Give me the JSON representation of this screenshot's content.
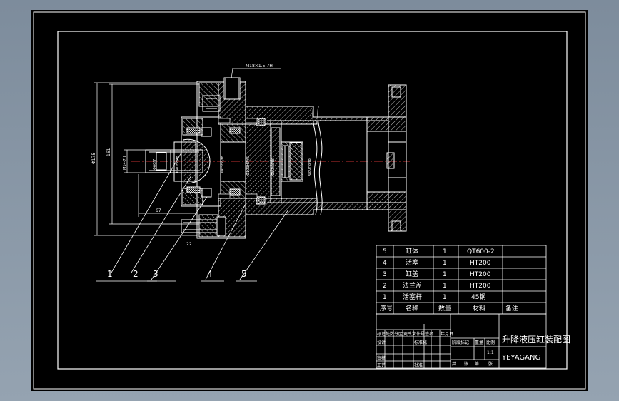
{
  "drawing": {
    "thread_callout": "M18×1.5-7H",
    "dimensions": {
      "overall_height": "Φ175",
      "bolt_circle": "161",
      "rod_thread": "M14-7H",
      "rod_dia": "Φ60f7",
      "inner_dia_1": "Φ40H8/f8",
      "cover_fit": "Φ65H8/f8",
      "piston_fit_1": "Φ100H7/f6",
      "piston_fit_2": "Φ50H8/f8",
      "bore": "Φ80H8/f8",
      "length_a": "67",
      "length_b": "22"
    },
    "balloons": [
      "1",
      "2",
      "3",
      "4",
      "5"
    ]
  },
  "parts_table": {
    "rows": [
      {
        "no": "5",
        "name": "缸体",
        "qty": "1",
        "material": "QT600-2",
        "note": ""
      },
      {
        "no": "4",
        "name": "活塞",
        "qty": "1",
        "material": "HT200",
        "note": ""
      },
      {
        "no": "3",
        "name": "缸盖",
        "qty": "1",
        "material": "HT200",
        "note": ""
      },
      {
        "no": "2",
        "name": "法兰盖",
        "qty": "1",
        "material": "HT200",
        "note": ""
      },
      {
        "no": "1",
        "name": "活塞杆",
        "qty": "1",
        "material": "45钢",
        "note": ""
      }
    ],
    "header": {
      "no": "序号",
      "name": "名称",
      "qty": "数量",
      "material": "材料",
      "note": "备注"
    }
  },
  "title_block": {
    "title": "升降液压缸装配图",
    "drawing_code": "YEYAGANG",
    "cells": [
      "标记",
      "处数",
      "分区",
      "更改文件号",
      "签名",
      "年月日",
      "设计",
      "标准化",
      "审核",
      "工艺",
      "批准",
      "阶段标记",
      "重量",
      "比例",
      "共",
      "张",
      "第",
      "张",
      "1:1"
    ]
  }
}
